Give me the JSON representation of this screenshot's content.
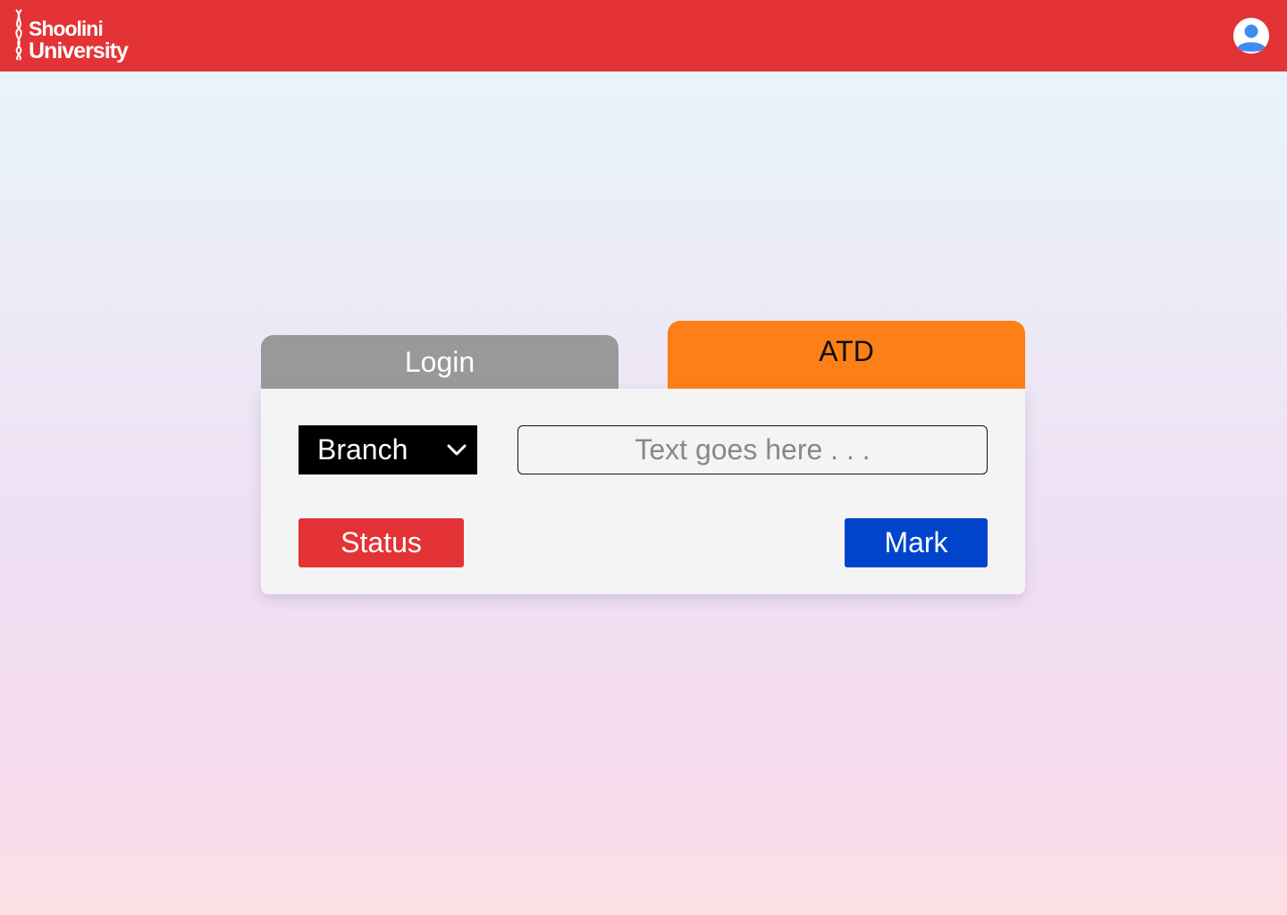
{
  "header": {
    "logo_line1": "Shoolini",
    "logo_line2": "University",
    "avatar_icon": "user-avatar-icon",
    "background_color": "#e33336"
  },
  "tabs": [
    {
      "label": "Login",
      "active": false,
      "color": "#999999"
    },
    {
      "label": "ATD",
      "active": true,
      "color": "#fc7f17"
    }
  ],
  "form": {
    "branch_select": {
      "selected": "Branch",
      "icon": "chevron-down-icon"
    },
    "text_input": {
      "value": "",
      "placeholder": "Text goes here . . ."
    },
    "status_button": {
      "label": "Status",
      "color": "#e33336"
    },
    "mark_button": {
      "label": "Mark",
      "color": "#0044cc"
    }
  }
}
